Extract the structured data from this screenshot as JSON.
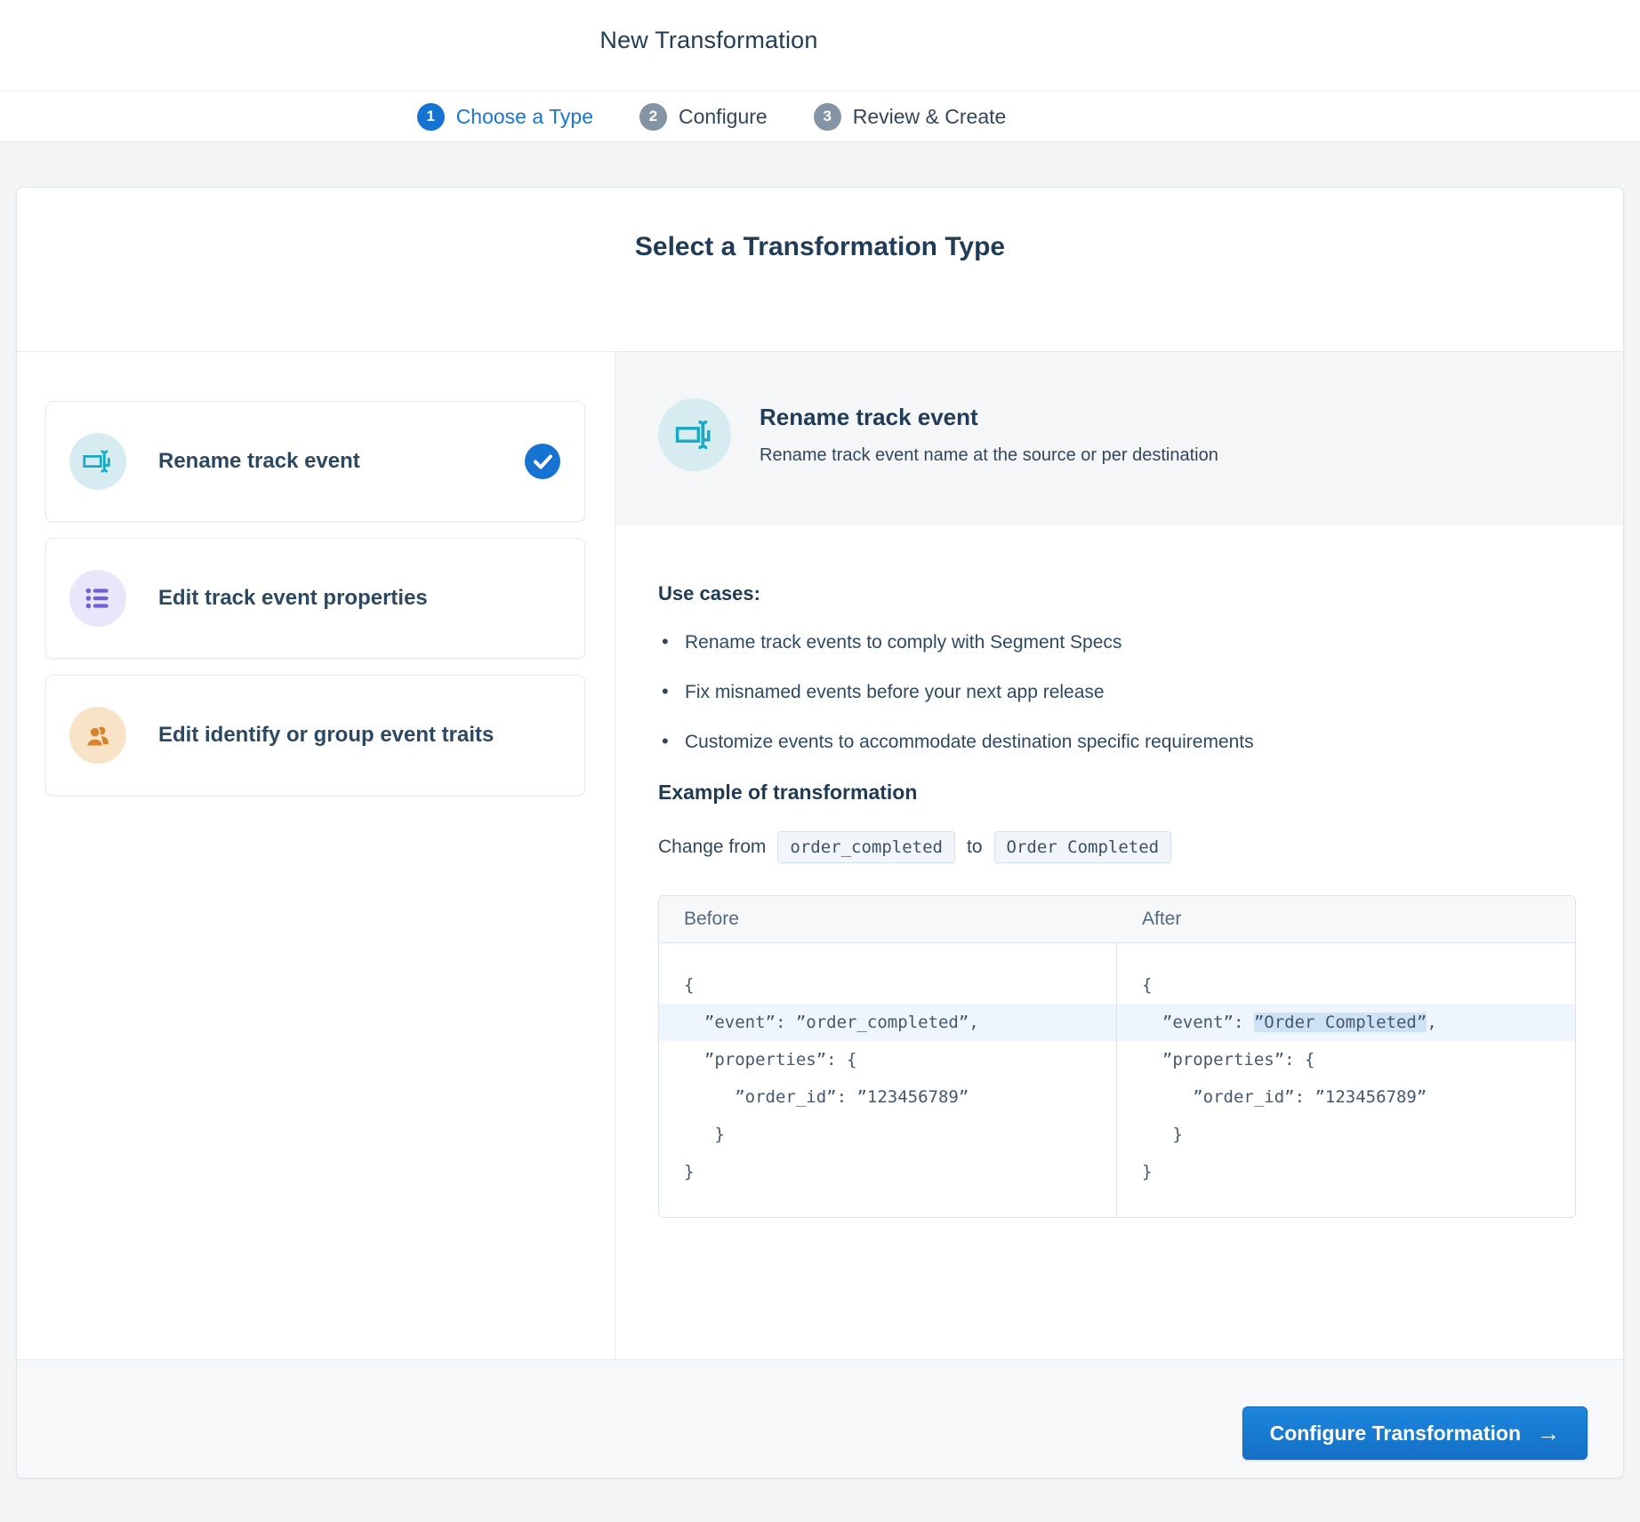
{
  "header": {
    "title": "New Transformation"
  },
  "stepper": {
    "steps": [
      {
        "number": "1",
        "label": "Choose a Type",
        "active": true
      },
      {
        "number": "2",
        "label": "Configure",
        "active": false
      },
      {
        "number": "3",
        "label": "Review & Create",
        "active": false
      }
    ]
  },
  "main": {
    "title": "Select a Transformation Type",
    "options": [
      {
        "label": "Rename track event",
        "icon": "rename-icon",
        "selected": true
      },
      {
        "label": "Edit track event properties",
        "icon": "list-icon",
        "selected": false
      },
      {
        "label": "Edit identify or group event traits",
        "icon": "users-icon",
        "selected": false
      }
    ],
    "detail": {
      "icon": "rename-icon",
      "title": "Rename track event",
      "description": "Rename track event name at the source or per destination",
      "use_cases_heading": "Use cases:",
      "use_cases": [
        "Rename track events to comply with Segment Specs",
        "Fix misnamed events before your next app release",
        "Customize events to accommodate destination specific requirements"
      ],
      "example_heading": "Example of transformation",
      "change": {
        "prefix": "Change from",
        "from_code": "order_completed",
        "connector": "to",
        "to_code": "Order Completed"
      },
      "comparison": {
        "before_label": "Before",
        "after_label": "After",
        "before_lines": [
          {
            "text": "{",
            "highlight_row": false
          },
          {
            "text": "  ”event”: ”order_completed”,",
            "highlight_row": true
          },
          {
            "text": "  ”properties”: {",
            "highlight_row": false
          },
          {
            "text": "     ”order_id”: ”123456789”",
            "highlight_row": false
          },
          {
            "text": "   }",
            "highlight_row": false
          },
          {
            "text": "}",
            "highlight_row": false
          }
        ],
        "after_lines": [
          {
            "text": "{",
            "highlight_row": false
          },
          {
            "pre": "  ”event”: ",
            "mark": "”Order Completed”",
            "post": ",",
            "highlight_row": true
          },
          {
            "text": "  ”properties”: {",
            "highlight_row": false
          },
          {
            "text": "     ”order_id”: ”123456789”",
            "highlight_row": false
          },
          {
            "text": "   }",
            "highlight_row": false
          },
          {
            "text": "}",
            "highlight_row": false
          }
        ]
      }
    }
  },
  "footer": {
    "button_label": "Configure Transformation",
    "arrow": "→"
  },
  "colors": {
    "accent_blue": "#1673d2",
    "link_blue": "#1a73d9",
    "teal_icon": "#1aa9c4",
    "purple_icon": "#7161d8",
    "orange_icon": "#d9822b",
    "inactive_step_gray": "#8494a4",
    "code_highlight": "#cde2f5"
  }
}
